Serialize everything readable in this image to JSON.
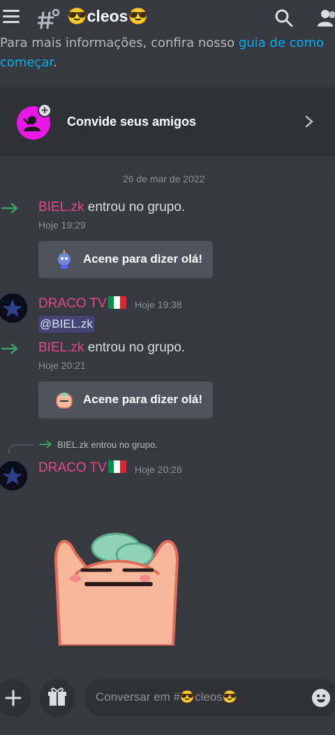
{
  "header": {
    "channel_name": "😎cleos😎",
    "menu_icon": "hamburger-icon",
    "thread_icon": "thread-hash-icon",
    "search_icon": "search-icon",
    "members_icon": "members-icon"
  },
  "intro": {
    "text_before": "Para mais informações, confira nosso ",
    "link_text": "guia de como começar",
    "text_after": "."
  },
  "invite": {
    "label": "Convide seus amigos",
    "icon": "add-friend-icon"
  },
  "date_divider": "26 de mar de 2022",
  "messages": [
    {
      "type": "join",
      "user": "BIEL.zk",
      "text": "entrou no grupo.",
      "time": "Hoje 19:29",
      "wave_label": "Acene para dizer olá!"
    },
    {
      "type": "message",
      "user": "DRACO TV",
      "time": "Hoje 19:38",
      "content": "@BIEL.zk"
    },
    {
      "type": "join",
      "user": "BIEL.zk",
      "text": "entrou no grupo.",
      "time": "Hoje 20:21",
      "wave_label": "Acene para dizer olá!"
    },
    {
      "type": "message",
      "user": "DRACO TV",
      "time": "Hoje 20:28",
      "reply_preview": "BIEL.zk entrou no grupo.",
      "sticker": "peach-cat-sticker"
    }
  ],
  "composer": {
    "placeholder": "Conversar em #😎cleos😎",
    "plus_icon": "plus-icon",
    "gift_icon": "gift-icon",
    "emoji_icon": "emoji-icon"
  },
  "colors": {
    "background": "#36393f",
    "username": "#e8478b",
    "link": "#00aff4",
    "join_arrow": "#3ba55c",
    "mention_bg": "#414675"
  }
}
